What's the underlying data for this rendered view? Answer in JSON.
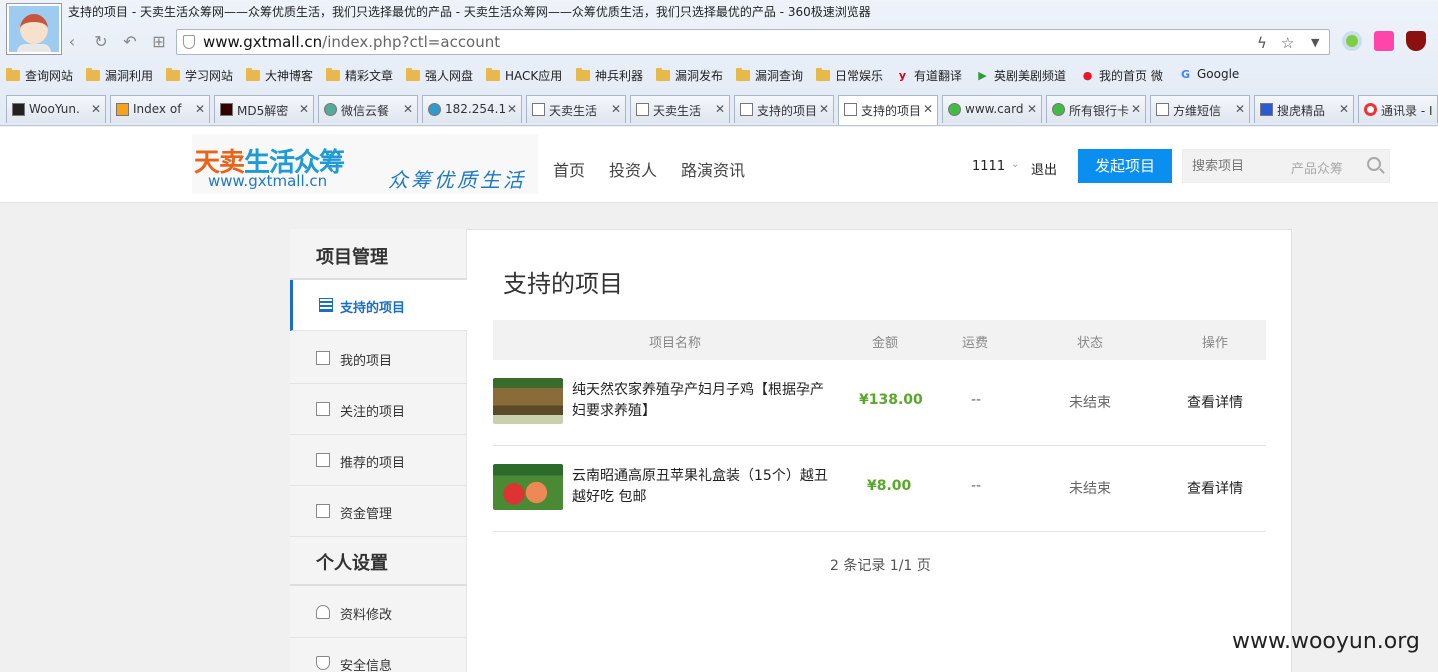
{
  "browser": {
    "window_title": "支持的项目 - 天卖生活众筹网——众筹优质生活，我们只选择最优的产品 - 天卖生活众筹网——众筹优质生活，我们只选择最优的产品 - 360极速浏览器",
    "url_host": "www.gxtmall.cn",
    "url_path": "/index.php?ctl=account",
    "bookmarks": [
      "查询网站",
      "漏洞利用",
      "学习网站",
      "大神博客",
      "精彩文章",
      "强人网盘",
      "HACK应用",
      "神兵利器",
      "漏洞发布",
      "漏洞查询",
      "日常娱乐",
      "有道翻译",
      "英剧美剧频道",
      "我的首页 微",
      "Google"
    ],
    "tabs": [
      "WooYun.",
      "Index of",
      "MD5解密",
      "微信云餐",
      "182.254.1",
      "天卖生活",
      "天卖生活",
      "支持的项目",
      "支持的项目",
      "www.card",
      "所有银行卡",
      "方维短信",
      "搜虎精品",
      "通讯录 - I"
    ],
    "active_tab_index": 8,
    "colors": {
      "accent": "#0a8ff0",
      "link_active": "#1a6fc4",
      "amount": "#5aa82a"
    }
  },
  "site": {
    "logo_brand_a": "天卖",
    "logo_brand_b": "生活众筹",
    "logo_url": "www.gxtmall.cn",
    "logo_slogan": "众筹优质生活",
    "nav": [
      "首页",
      "投资人",
      "路演资讯"
    ],
    "user": "1111",
    "logout": "退出",
    "launch_button": "发起项目",
    "search_placeholder": "搜索项目",
    "search_category": "产品众筹"
  },
  "sidebar": {
    "section1": "项目管理",
    "items1": [
      "支持的项目",
      "我的项目",
      "关注的项目",
      "推荐的项目",
      "资金管理"
    ],
    "section2": "个人设置",
    "items2": [
      "资料修改",
      "安全信息"
    ]
  },
  "main": {
    "title": "支持的项目",
    "columns": [
      "项目名称",
      "金额",
      "运费",
      "状态",
      "操作"
    ],
    "rows": [
      {
        "name": "纯天然农家养殖孕产妇月子鸡【根据孕产妇要求养殖】",
        "amount": "¥138.00",
        "shipping": "--",
        "status": "未结束",
        "action": "查看详情"
      },
      {
        "name": "云南昭通高原丑苹果礼盒装（15个）越丑越好吃 包邮",
        "amount": "¥8.00",
        "shipping": "--",
        "status": "未结束",
        "action": "查看详情"
      }
    ],
    "pager": "2 条记录 1/1 页"
  },
  "watermark": "www.wooyun.org"
}
